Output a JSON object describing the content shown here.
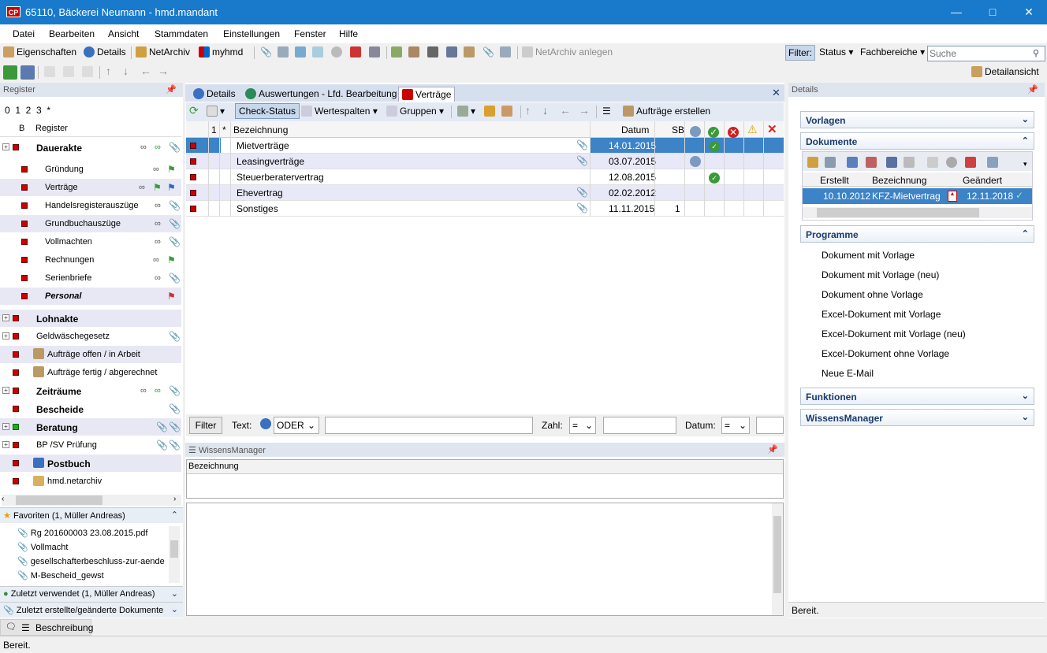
{
  "window": {
    "title": "65110, Bäckerei Neumann - hmd.mandant",
    "logo": "CP"
  },
  "menu": [
    "Datei",
    "Bearbeiten",
    "Ansicht",
    "Stammdaten",
    "Einstellungen",
    "Fenster",
    "Hilfe"
  ],
  "toolbar": {
    "properties": "Eigenschaften",
    "details": "Details",
    "netarchiv": "NetArchiv",
    "myhmd": "myhmd",
    "netarchiv_create": "NetArchiv anlegen",
    "filter": "Filter:",
    "status": "Status",
    "fachbereiche": "Fachbereiche",
    "search_placeholder": "Suche",
    "detail_view": "Detailansicht"
  },
  "left": {
    "header": "Register",
    "levels": "0  1  2  3  *",
    "col_b": "B",
    "col_register": "Register",
    "items": [
      {
        "label": "Dauerakte",
        "bold": true
      },
      {
        "label": "Gründung"
      },
      {
        "label": "Verträge"
      },
      {
        "label": "Handelsregisterauszüge"
      },
      {
        "label": "Grundbuchauszüge"
      },
      {
        "label": "Vollmachten"
      },
      {
        "label": "Rechnungen"
      },
      {
        "label": "Serienbriefe"
      },
      {
        "label": "Personal"
      },
      {
        "label": "Lohnakte"
      },
      {
        "label": "Geldwäschegesetz"
      },
      {
        "label": "Aufträge offen / in Arbeit"
      },
      {
        "label": "Aufträge fertig / abgerechnet"
      },
      {
        "label": "Zeiträume"
      },
      {
        "label": "Bescheide"
      },
      {
        "label": "Beratung"
      },
      {
        "label": "BP /SV Prüfung"
      },
      {
        "label": "Postbuch"
      },
      {
        "label": "hmd.netarchiv"
      }
    ],
    "favorites_header": "Favoriten (1, Müller Andreas)",
    "favorites": [
      "Rg 201600003 23.08.2015.pdf",
      "Vollmacht",
      "gesellschafterbeschluss-zur-aende",
      "M-Bescheid_gewst"
    ],
    "recent_used": "Zuletzt verwendet (1, Müller Andreas)",
    "recent_docs": "Zuletzt erstellte/geänderte Dokumente"
  },
  "center": {
    "tabs": [
      "Details",
      "Auswertungen - Lfd. Bearbeitung",
      "Verträge"
    ],
    "toolbar": {
      "check_status": "Check-Status",
      "wertespalten": "Wertespalten",
      "gruppen": "Gruppen",
      "auftraege": "Aufträge erstellen"
    },
    "columns": {
      "num": "1",
      "star": "*",
      "name": "Bezeichnung",
      "date": "Datum",
      "sb": "SB"
    },
    "rows": [
      {
        "name": "Mietverträge",
        "date": "14.01.2015",
        "sb": ""
      },
      {
        "name": "Leasingverträge",
        "date": "03.07.2015",
        "sb": ""
      },
      {
        "name": "Steuerberatervertrag",
        "date": "12.08.2015",
        "sb": ""
      },
      {
        "name": "Ehevertrag",
        "date": "02.02.2012",
        "sb": ""
      },
      {
        "name": "Sonstiges",
        "date": "11.11.2015",
        "sb": "1"
      }
    ],
    "filter": {
      "button": "Filter",
      "text_label": "Text:",
      "mode": "ODER",
      "zahl_label": "Zahl:",
      "zahl_op": "=",
      "datum_label": "Datum:",
      "datum_op": "="
    },
    "wissensmanager": {
      "header": "WissensManager",
      "col": "Bezeichnung"
    }
  },
  "right": {
    "header": "Details",
    "sections": {
      "vorlagen": "Vorlagen",
      "dokumente": "Dokumente",
      "programme": "Programme",
      "funktionen": "Funktionen",
      "wissensmanager": "WissensManager"
    },
    "doc_columns": {
      "created": "Erstellt",
      "name": "Bezeichnung",
      "changed": "Geändert"
    },
    "doc_row": {
      "created": "10.10.2012",
      "name": "KFZ-Mietvertrag",
      "changed": "12.11.2018"
    },
    "programs": [
      "Dokument mit Vorlage",
      "Dokument mit Vorlage (neu)",
      "Dokument ohne Vorlage",
      "Excel-Dokument mit Vorlage",
      "Excel-Dokument mit Vorlage (neu)",
      "Excel-Dokument ohne Vorlage",
      "Neue E-Mail"
    ],
    "status": "Bereit."
  },
  "bottom": {
    "tab": "Beschreibung",
    "status": "Bereit."
  }
}
